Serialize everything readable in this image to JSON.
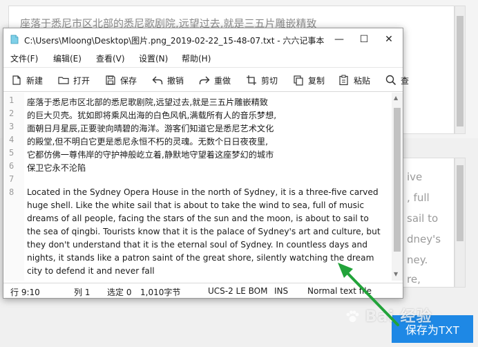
{
  "background": {
    "top_pane_text": "座落于悉尼市区北部的悉尼歌剧院,远望过去,就是三五片雕嵌精致",
    "right_pane_lines": [
      "ive",
      ", full",
      "sail to",
      "dney's",
      "ney.",
      "re,"
    ],
    "save_txt_button": "保存为TXT",
    "watermark": "Bai 经验"
  },
  "window": {
    "title": "C:\\Users\\Mloong\\Desktop\\图片.png_2019-02-22_15-48-07.txt - 六六记事本",
    "controls": {
      "minimize": "—",
      "maximize": "☐",
      "close": "✕"
    }
  },
  "menu": [
    "文件(F)",
    "编辑(E)",
    "查看(V)",
    "设置(N)",
    "帮助(H)"
  ],
  "toolbar": {
    "new": "新建",
    "open": "打开",
    "save": "保存",
    "undo": "撤销",
    "redo": "重做",
    "cut": "剪切",
    "copy": "复制",
    "paste": "粘贴",
    "find": "查"
  },
  "editor": {
    "line_numbers": [
      "1",
      "2",
      "3",
      "4",
      "5",
      "6",
      "7",
      "8"
    ],
    "lines": [
      "座落于悉尼市区北部的悉尼歌剧院,远望过去,就是三五片雕嵌精致",
      "的巨大贝壳。犹如即将乘风出海的白色风帆,满载所有人的音乐梦想,",
      "面朝日月星辰,正要驶向晴碧的海洋。游客们知道它是悉尼艺术文化",
      "的殿堂,但不明白它更是悉尼永恒不朽的灵魂。无数个日日夜夜里,",
      "它都仿佛一尊伟岸的守护神般屹立着,静默地守望着这座梦幻的城市",
      "保卫它永不沦陷",
      "",
      "Located in the Sydney Opera House in the north of Sydney, it is a three-five carved",
      "huge shell. Like the white sail that is about to take the wind to sea, full of music",
      "dreams of all people, facing the stars of the sun and the moon, is about to sail to",
      "the sea of qingbi. Tourists know that it is the palace of Sydney's art and culture, but",
      "they don't understand that it is the eternal soul of Sydney. In countless days and",
      "nights, it stands like a patron saint of the great shore, silently watching the dream",
      "city to defend it and never fall"
    ]
  },
  "status": {
    "line": "行 9:10",
    "column": "列 1",
    "selection": "选定 0",
    "size": "1,010字节",
    "encoding": "UCS-2 LE BOM",
    "mode": "INS",
    "file_type": "Normal text file"
  },
  "colors": {
    "accent_button": "#1e88e5",
    "annotation_arrow": "#22a33a"
  }
}
